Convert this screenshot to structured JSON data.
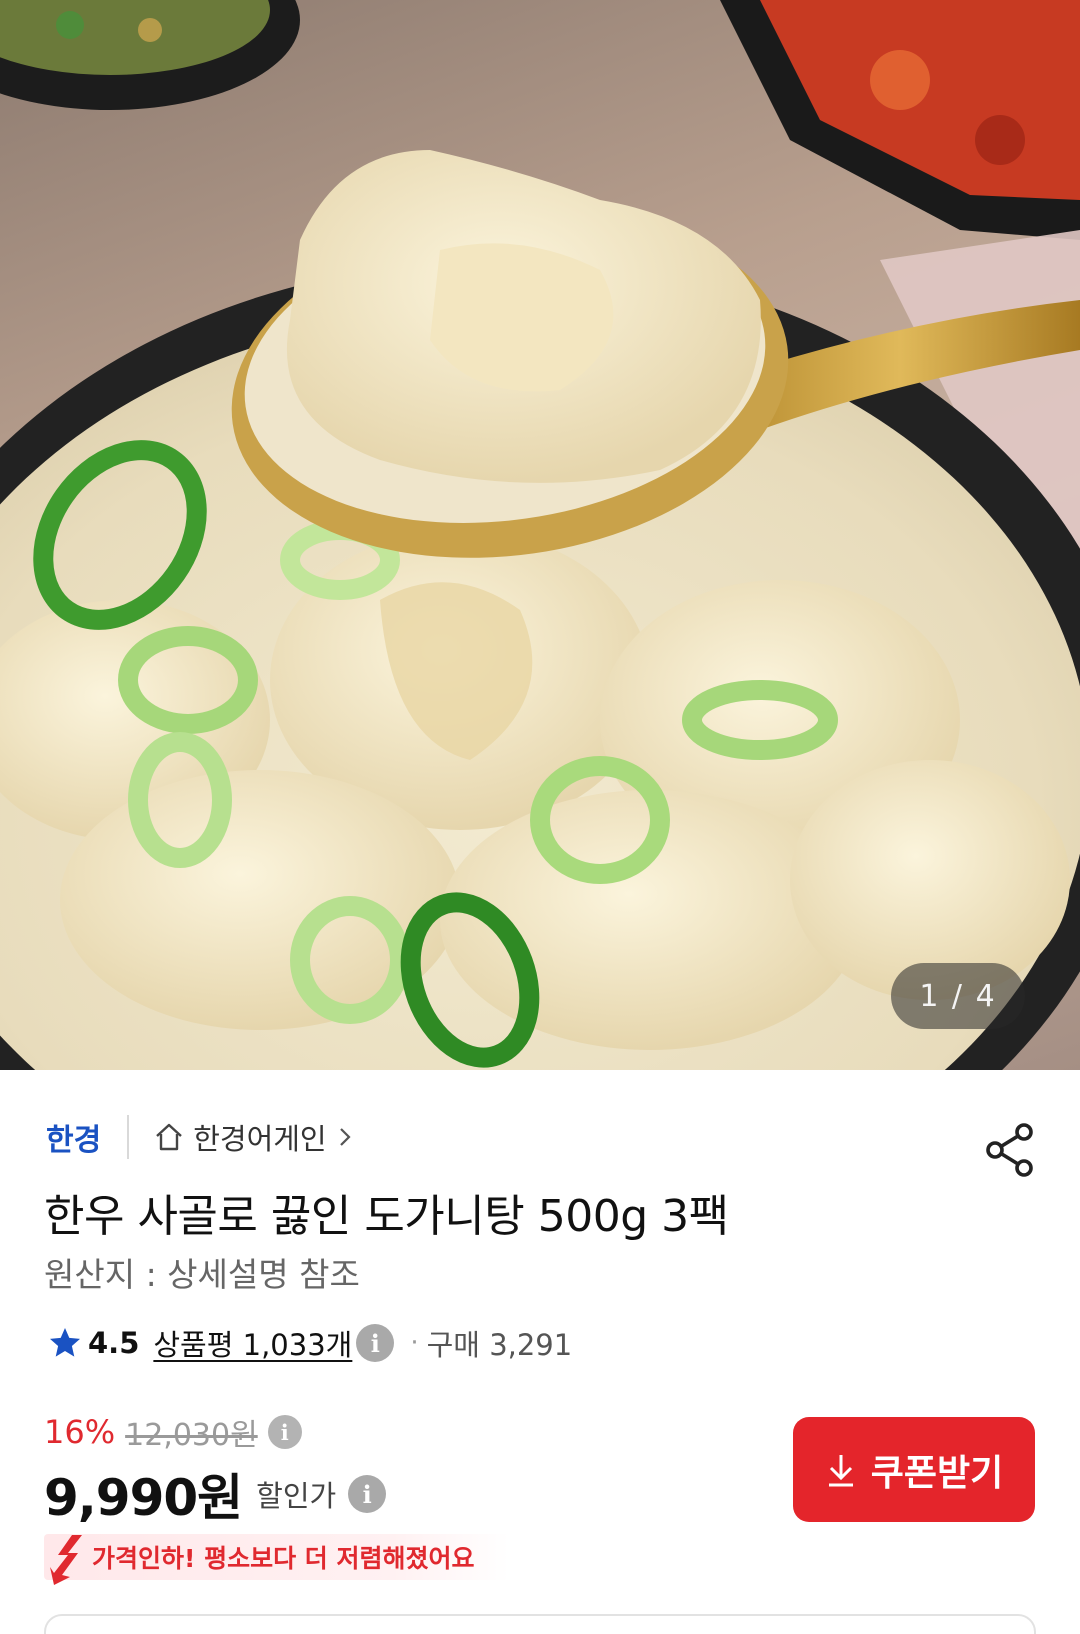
{
  "hero": {
    "image_alt": "",
    "counter": "1 / 4"
  },
  "store_row": {
    "brand": "한경",
    "store_name": "한경어게인"
  },
  "product": {
    "title": "한우 사골로 끓인 도가니탕 500g 3팩",
    "origin": "원산지 : 상세설명 참조"
  },
  "rating": {
    "score": "4.5",
    "reviews": "상품평 1,033개",
    "purchases": "구매 3,291"
  },
  "pricing": {
    "discount": "16%",
    "original_price": "12,030원",
    "price": "9,990원",
    "price_suffix": "할인가"
  },
  "coupon_button": {
    "label": "쿠폰받기"
  },
  "notice": {
    "text": "가격인하! 평소보다 더 저렴해졌어요"
  },
  "icons": {
    "share": "share-icon",
    "home": "home-icon",
    "star": "star-icon",
    "info": "info-icon",
    "download": "download-icon",
    "price_down": "price-down-arrow-icon"
  },
  "colors": {
    "brand_blue": "#1a52c2",
    "accent_red": "#e4252b",
    "notice_bg": "#ffe8ea"
  }
}
